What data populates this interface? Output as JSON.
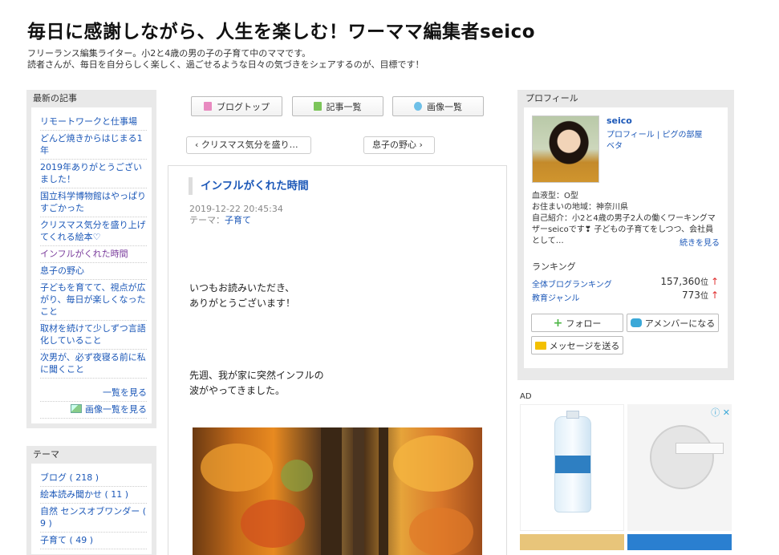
{
  "header": {
    "title": "毎日に感謝しながら、人生を楽しむ！ワーママ編集者seico",
    "desc_line1": "フリーランス編集ライター。小2と4歳の男の子の子育て中のママです。",
    "desc_line2": "読者さんが、毎日を自分らしく楽しく、過ごせるような日々の気づきをシェアするのが、目標です！"
  },
  "left": {
    "recent_title": "最新の記事",
    "articles": [
      "リモートワークと仕事場",
      "どんど焼きからはじまる1年",
      "2019年ありがとうございました！",
      "国立科学博物館はやっぱりすごかった",
      "クリスマス気分を盛り上げてくれる絵本♡",
      "インフルがくれた時間",
      "息子の野心",
      "子どもを育てて、視点が広がり、毎日が楽しくなったこと",
      "取材を続けて少しずつ言語化していること",
      "次男が、必ず夜寝る前に私に聞くこと"
    ],
    "more_list": "一覧を見る",
    "more_images": "画像一覧を見る",
    "theme_title": "テーマ",
    "themes": [
      "ブログ ( 218 )",
      "絵本読み聞かせ ( 11 )",
      "自然 センスオブワンダー ( 9 )",
      "子育て ( 49 )"
    ]
  },
  "center": {
    "btn_top": "ブログトップ",
    "btn_list": "記事一覧",
    "btn_images": "画像一覧",
    "prev": "クリスマス気分を盛り…",
    "next": "息子の野心",
    "article_title": "インフルがくれた時間",
    "date": "2019-12-22 20:45:34",
    "theme_label": "テーマ：",
    "theme_value": "子育て",
    "p1_line1": "いつもお読みいただき、",
    "p1_line2": "ありがとうございます！",
    "p2_line1": "先週、我が家に突然インフル",
    "p2_line2": "の",
    "p2_line3": "波がやってきました。"
  },
  "right": {
    "profile_title": "プロフィール",
    "name": "seico",
    "link_profile": "プロフィール",
    "link_room": "ピグの部屋",
    "link_beta": "ベタ",
    "blood": "血液型：O型",
    "area": "お住まいの地域：神奈川県",
    "intro": "自己紹介：小2と4歳の男子2人の働くワーキングマザーseicoです❣ 子どもの子育てをしつつ、会社員として…",
    "see_more": "続きを見る",
    "ranking_title": "ランキング",
    "rank1_label": "全体ブログランキング",
    "rank1_value": "157,360",
    "rank2_label": "教育ジャンル",
    "rank2_value": "773",
    "rank_unit": "位",
    "rank_arrow": "↑",
    "follow": "フォロー",
    "amember": "アメンバーになる",
    "message": "メッセージを送る",
    "ad_label": "AD",
    "ad_close": "ⓘ ✕"
  }
}
